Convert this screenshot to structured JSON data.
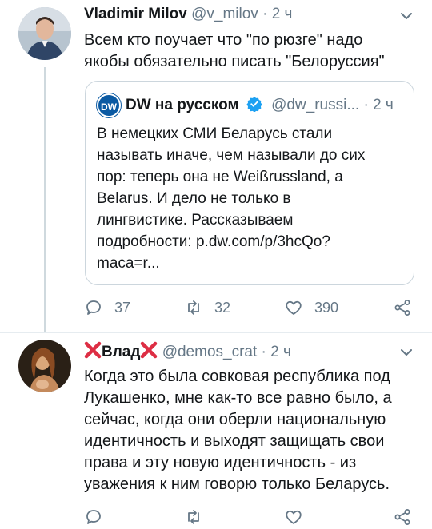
{
  "tweet1": {
    "name": "Vladimir Milov",
    "handle": "@v_milov",
    "separator": "·",
    "time": "2 ч",
    "text": "Всем кто поучает что \"по рюзге\" надо\nякобы обязательно писать \"Белоруссия\"",
    "quoted": {
      "name": "DW на русском",
      "handle": "@dw_russi...",
      "separator": "·",
      "time": "2 ч",
      "avatar_label": "DW",
      "text": "В немецких СМИ Беларусь стали\nназывать иначе, чем называли до сих\nпор: теперь она не Weißrussland, а\nBelarus. И дело не только в\nлингвистике. Рассказываем\nподробности: p.dw.com/p/3hcQo?\nmaca=r..."
    },
    "replies": "37",
    "retweets": "32",
    "likes": "390"
  },
  "tweet2": {
    "name": "Влад",
    "handle": "@demos_crat",
    "separator": "·",
    "time": "2 ч",
    "text": "Когда это была совковая республика под\nЛукашенко, мне как-то все равно было, а\nсейчас, когда они оберли национальную\nидентичность и выходят защищать свои\nправа и эту новую идентичность - из\nуважения к ним говорю только Беларусь."
  },
  "colors": {
    "text": "#14171a",
    "secondary": "#657786",
    "verified": "#1da1f2",
    "red_cross": "#dd2e44"
  }
}
